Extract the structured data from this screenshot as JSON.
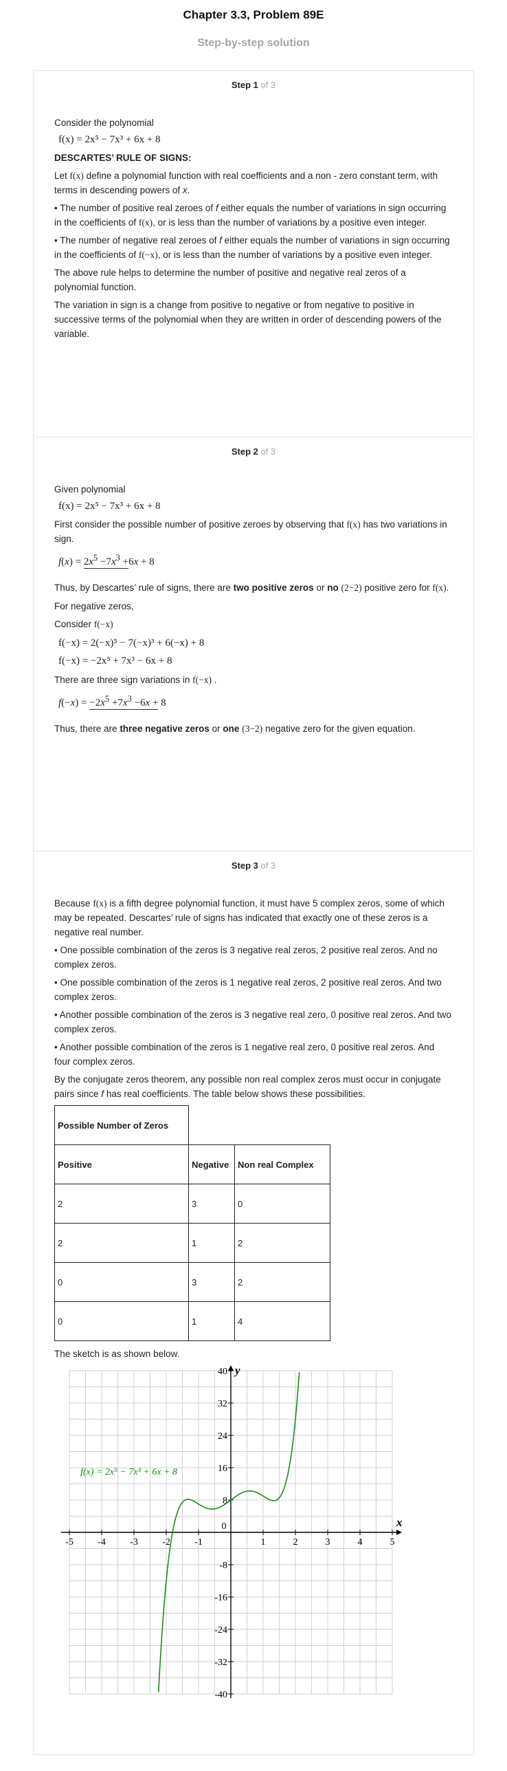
{
  "header": {
    "title": "Chapter 3.3, Problem 89E",
    "subtitle": "Step-by-step solution"
  },
  "steps": [
    {
      "label": "Step 1",
      "of": " of 3"
    },
    {
      "label": "Step 2",
      "of": " of 3"
    },
    {
      "label": "Step 3",
      "of": " of 3"
    }
  ],
  "step1": {
    "intro": "Consider the polynomial",
    "rule_title": "DESCARTES’ RULE OF SIGNS:",
    "let_a": "Let",
    "let_b": "define a polynomial function with real coefficients and a non - zero constant term, with terms in descending powers of",
    "let_x": "x",
    "b1_a": "• The number of positive real zeroes of",
    "b1_f": "f",
    "b1_b": "either equals the number of variations in sign occurring in the coefficients of",
    "b1_c": ", or is less than the number of variations by a positive even integer.",
    "b2_a": "• The number of negative real zeroes of",
    "b2_f": "f",
    "b2_b": "either equals the number of variations in sign occurring in the coefficients of",
    "b2_c": ", or is less than the number of variations by a positive even integer.",
    "p3": "The above rule helps to determine the number of positive and negative real zeros of a polynomial function.",
    "p4": "The variation in sign is a change from positive to negative or from negative to positive in successive terms of the polynomial when they are written in order of descending powers of the variable."
  },
  "step2": {
    "given": "Given polynomial",
    "first_a": "First consider the possible number of positive zeroes by observing that",
    "first_b": "has two variations in sign.",
    "thus_a": "Thus, by Descartes’ rule of signs, there are",
    "thus_b": "two positive zeros",
    "thus_c": "or",
    "thus_d": "no",
    "thus_e": "positive zero for",
    "paren22": "(2−2)",
    "neg_title": "For negative zeros,",
    "consider": "Consider",
    "three_a": "There are three sign variations in",
    "three_b": ".",
    "final_a": "Thus, there are",
    "final_b": "three negative zeros",
    "final_c": "or",
    "final_d": "one",
    "paren32": "(3−2)",
    "final_e": "negative zero for the given equation."
  },
  "step3": {
    "because_a": "Because",
    "because_b": "is a fifth degree polynomial function, it must have 5 complex zeros, some of which may be repeated. Descartes’ rule of signs has indicated that exactly one of these zeros is a negative real number.",
    "c1": "• One possible combination of the zeros is 3 negative real zeros, 2 positive real zeros. And no complex zeros.",
    "c2": "• One possible combination of the zeros is 1 negative real zeros, 2 positive real zeros. And two complex zeros.",
    "c3": "• Another possible combination of the zeros is 3 negative real zero, 0 positive real zeros. And two complex zeros.",
    "c4": "• Another possible combination of the zeros is 1 negative real zero, 0 positive real zeros. And four complex zeros.",
    "conj_a": "By the conjugate zeros theorem, any possible non real complex zeros must occur in conjugate pairs since",
    "conj_f": "f",
    "conj_b": "has real coefficients. The table below shows these possibilities.",
    "table": {
      "title": "Possible Number of Zeros",
      "headers": [
        "Positive",
        "Negative",
        "Non real Complex"
      ],
      "rows": [
        [
          "2",
          "3",
          "0"
        ],
        [
          "2",
          "1",
          "2"
        ],
        [
          "0",
          "3",
          "2"
        ],
        [
          "0",
          "1",
          "4"
        ]
      ]
    },
    "sketch": "The sketch is as shown below."
  },
  "math": {
    "fx": "f(x)",
    "fnegx": "f(−x)",
    "poly": "f(x) = 2x⁵ − 7x³ + 6x + 8",
    "neg1": "f(−x) = 2(−x)⁵ − 7(−x)³ + 6(−x) + 8",
    "neg2": "f(−x) = −2x⁵ + 7x³ − 6x + 8"
  },
  "chart_data": {
    "type": "line",
    "title": "",
    "xlabel": "x",
    "ylabel": "y",
    "xlim": [
      -5,
      5
    ],
    "ylim": [
      -40,
      40
    ],
    "x_ticks": [
      "-5",
      "-4",
      "-3",
      "-2",
      "-1",
      "0",
      "1",
      "2",
      "3",
      "4",
      "5"
    ],
    "y_ticks": [
      "40",
      "32",
      "24",
      "16",
      "8",
      "-8",
      "-16",
      "-24",
      "-32",
      "-40"
    ],
    "grid": true,
    "series": [
      {
        "name": "f(x) = 2x⁵ − 7x³ + 6x + 8",
        "expression": "2x^5 - 7x^3 + 6x + 8",
        "color": "#1a8a1a"
      }
    ],
    "annotation": "f(x) = 2x⁵ − 7x³ + 6x + 8"
  }
}
